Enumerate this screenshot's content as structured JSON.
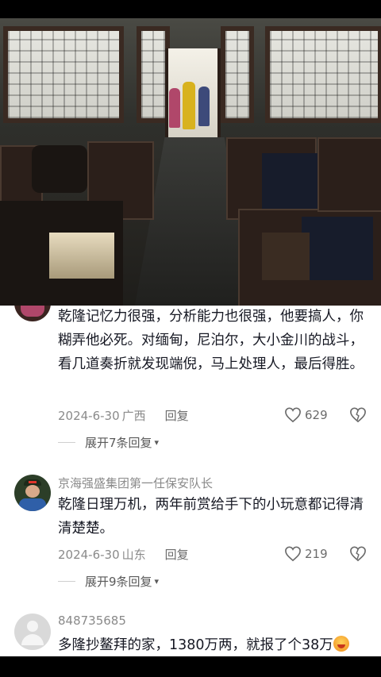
{
  "comments": [
    {
      "text": "乾隆记忆力很强，分析能力也很强，他要搞人，你糊弄他必死。对缅甸，尼泊尔，大小金川的战斗，看几道奏折就发现端倪，马上处理人，最后得胜。",
      "date": "2024-6-30",
      "location": "广西",
      "reply_label": "回复",
      "likes": "629",
      "expand_label": "展开7条回复"
    },
    {
      "username": "京海强盛集团第一任保安队长",
      "text": "乾隆日理万机，两年前赏给手下的小玩意都记得清清楚楚。",
      "date": "2024-6-30",
      "location": "山东",
      "reply_label": "回复",
      "likes": "219",
      "expand_label": "展开9条回复"
    },
    {
      "username": "848735685",
      "text": "多隆抄鳌拜的家，1380万两，就报了个38万"
    }
  ],
  "icons": {
    "like": "heart-outline-icon",
    "dislike": "broken-heart-icon",
    "expand": "chevron-down-icon"
  },
  "colors": {
    "text": "#161823",
    "meta": "#8a8a8a"
  }
}
